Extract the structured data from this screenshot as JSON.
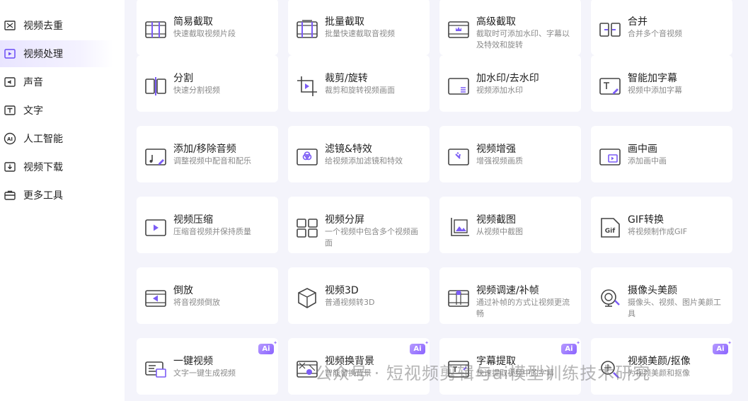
{
  "colors": {
    "accent": "#6a4cf5",
    "active_bg": "#ebe7ff",
    "icon": "#3a3a3a"
  },
  "sidebar": {
    "items": [
      {
        "label": "视频去重",
        "icon": "dedupe-icon",
        "active": false
      },
      {
        "label": "视频处理",
        "icon": "video-process-icon",
        "active": true
      },
      {
        "label": "声音",
        "icon": "sound-icon",
        "active": false
      },
      {
        "label": "文字",
        "icon": "text-icon",
        "active": false
      },
      {
        "label": "人工智能",
        "icon": "ai-icon",
        "active": false
      },
      {
        "label": "视频下载",
        "icon": "download-icon",
        "active": false
      },
      {
        "label": "更多工具",
        "icon": "toolbox-icon",
        "active": false
      }
    ]
  },
  "tools": [
    {
      "title": "简易截取",
      "desc": "快速截取视频片段",
      "icon": "simple-trim-icon"
    },
    {
      "title": "批量截取",
      "desc": "批量快速截取音视频",
      "icon": "batch-trim-icon"
    },
    {
      "title": "高级截取",
      "desc": "截取时可添加水印、字幕以及特效和旋转",
      "icon": "advanced-trim-icon"
    },
    {
      "title": "合并",
      "desc": "合并多个音视频",
      "icon": "merge-icon"
    },
    {
      "title": "分割",
      "desc": "快速分割视频",
      "icon": "split-icon"
    },
    {
      "title": "裁剪/旋转",
      "desc": "裁剪和旋转视频画面",
      "icon": "crop-rotate-icon"
    },
    {
      "title": "加水印/去水印",
      "desc": "视频添加水印",
      "icon": "watermark-icon"
    },
    {
      "title": "智能加字幕",
      "desc": "视频中添加字幕",
      "icon": "subtitle-icon"
    },
    {
      "title": "添加/移除音频",
      "desc": "调整视频中配音和配乐",
      "icon": "audio-icon"
    },
    {
      "title": "滤镜&特效",
      "desc": "给视频添加滤镜和特效",
      "icon": "filter-icon"
    },
    {
      "title": "视频增强",
      "desc": "增强视频画质",
      "icon": "enhance-icon"
    },
    {
      "title": "画中画",
      "desc": "添加画中画",
      "icon": "pip-icon"
    },
    {
      "title": "视频压缩",
      "desc": "压缩音视频并保持质量",
      "icon": "compress-icon"
    },
    {
      "title": "视频分屏",
      "desc": "一个视频中包含多个视频画面",
      "icon": "split-screen-icon"
    },
    {
      "title": "视频截图",
      "desc": "从视频中截图",
      "icon": "screenshot-icon"
    },
    {
      "title": "GIF转换",
      "desc": "将视频制作成GIF",
      "icon": "gif-icon"
    },
    {
      "title": "倒放",
      "desc": "将音视频倒放",
      "icon": "reverse-icon"
    },
    {
      "title": "视频3D",
      "desc": "普通视频转3D",
      "icon": "cube-3d-icon"
    },
    {
      "title": "视频调速/补帧",
      "desc": "通过补帧的方式让视频更流畅",
      "icon": "speed-icon"
    },
    {
      "title": "摄像头美颜",
      "desc": "摄像头、视频、图片美颜工具",
      "icon": "camera-beauty-icon"
    },
    {
      "title": "一键视频",
      "desc": "文字一键生成视频",
      "icon": "one-click-video-icon",
      "ai": true
    },
    {
      "title": "视频换背景",
      "desc": "智能替换背景",
      "icon": "background-icon",
      "ai": true
    },
    {
      "title": "字幕提取",
      "desc": "快速提取视频中的字幕",
      "icon": "subtitle-extract-icon",
      "ai": true
    },
    {
      "title": "视频美颜/抠像",
      "desc": "为视频美颜和抠像",
      "icon": "beauty-matting-icon",
      "ai": true
    }
  ],
  "ai_badge_label": "Ai",
  "watermark": "公众号 · 短视频剪辑与ai模型训练技术研究"
}
